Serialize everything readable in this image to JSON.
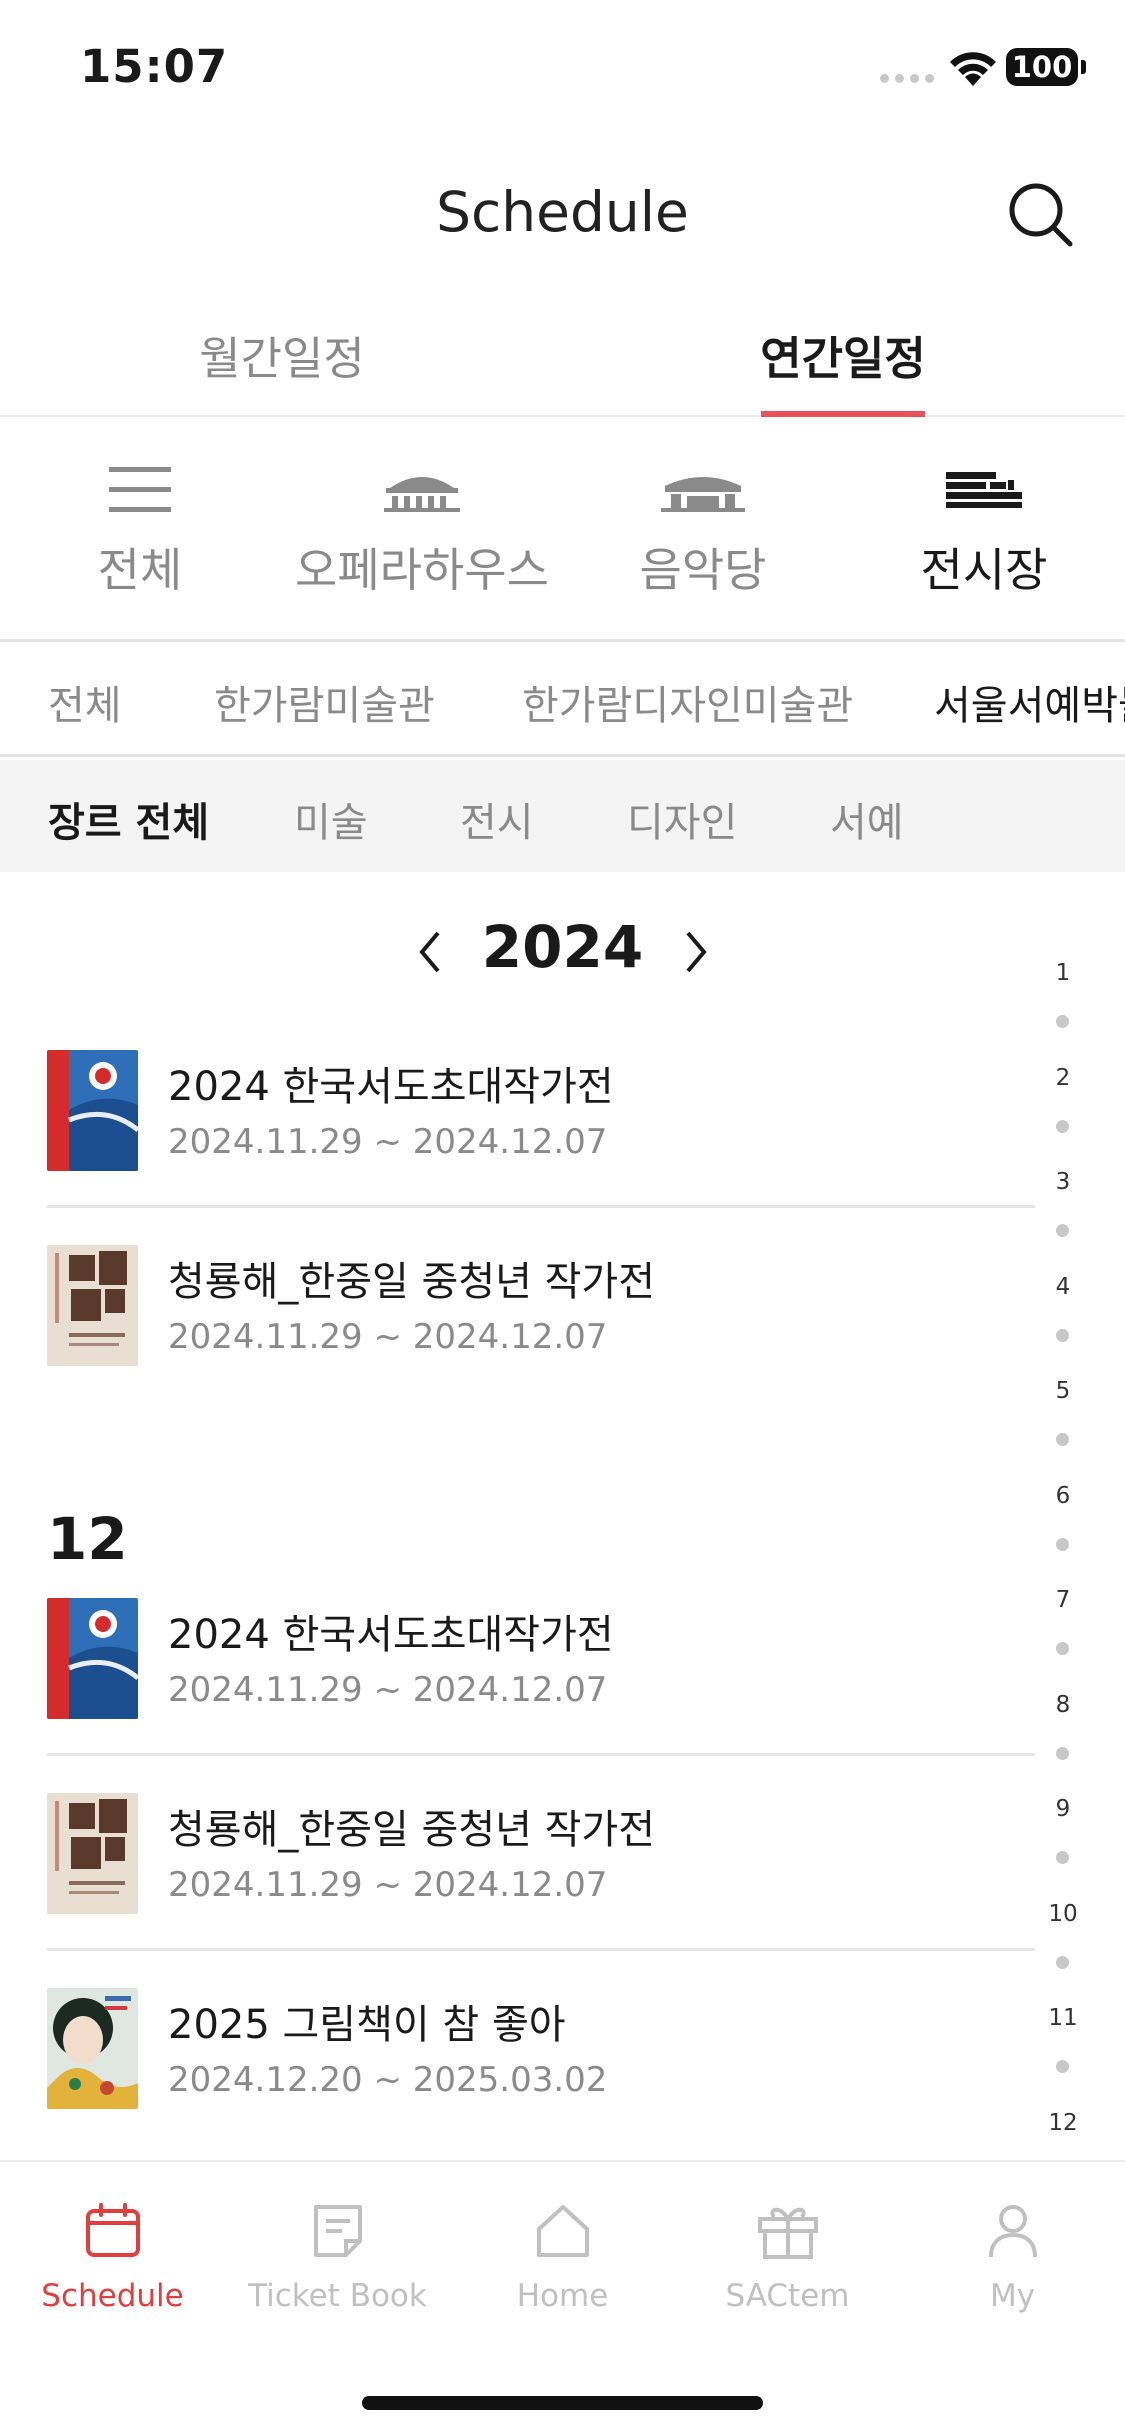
{
  "status_bar": {
    "time": "15:07",
    "battery": "100"
  },
  "header": {
    "title": "Schedule",
    "search_icon": "search-icon"
  },
  "main_tabs": [
    {
      "label": "월간일정",
      "active": false
    },
    {
      "label": "연간일정",
      "active": true
    }
  ],
  "venues": [
    {
      "label": "전체",
      "icon": "list-icon",
      "active": false
    },
    {
      "label": "오페라하우스",
      "icon": "opera-house-icon",
      "active": false
    },
    {
      "label": "음악당",
      "icon": "concert-hall-icon",
      "active": false
    },
    {
      "label": "전시장",
      "icon": "exhibition-hall-icon",
      "active": true
    }
  ],
  "sub_venues": [
    {
      "label": "전체",
      "active": false
    },
    {
      "label": "한가람미술관",
      "active": false
    },
    {
      "label": "한가람디자인미술관",
      "active": false
    },
    {
      "label": "서울서예박물관",
      "active": true
    }
  ],
  "genres": [
    {
      "label": "장르 전체",
      "active": true
    },
    {
      "label": "미술",
      "active": false
    },
    {
      "label": "전시",
      "active": false
    },
    {
      "label": "디자인",
      "active": false
    },
    {
      "label": "서예",
      "active": false
    }
  ],
  "year_nav": {
    "year": "2024"
  },
  "month_heading": "12",
  "events": [
    {
      "title": "2024 한국서도초대작가전",
      "date": "2024.11.29 ~ 2024.12.07"
    },
    {
      "title": "청룡해_한중일 중청년 작가전",
      "date": "2024.11.29 ~ 2024.12.07"
    },
    {
      "title": "2024 한국서도초대작가전",
      "date": "2024.11.29 ~ 2024.12.07"
    },
    {
      "title": "청룡해_한중일 중청년 작가전",
      "date": "2024.11.29 ~ 2024.12.07"
    },
    {
      "title": "2025 그림책이 참 좋아",
      "date": "2024.12.20 ~ 2025.03.02"
    }
  ],
  "month_index": [
    "1",
    "2",
    "3",
    "4",
    "5",
    "6",
    "7",
    "8",
    "9",
    "10",
    "11",
    "12"
  ],
  "bottom_nav": [
    {
      "label": "Schedule",
      "icon": "calendar-icon",
      "active": true
    },
    {
      "label": "Ticket Book",
      "icon": "ticket-book-icon",
      "active": false
    },
    {
      "label": "Home",
      "icon": "home-icon",
      "active": false
    },
    {
      "label": "SACtem",
      "icon": "gift-icon",
      "active": false
    },
    {
      "label": "My",
      "icon": "user-icon",
      "active": false
    }
  ],
  "colors": {
    "accent": "#e8505b",
    "active_nav": "#e23e3e",
    "muted": "#8a8a8a"
  }
}
